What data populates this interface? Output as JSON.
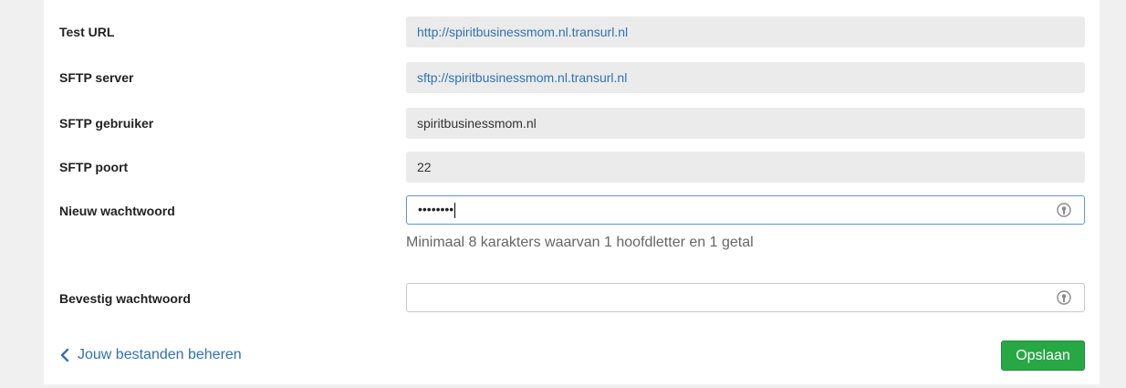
{
  "form": {
    "test_url": {
      "label": "Test URL",
      "value": "http://spiritbusinessmom.nl.transurl.nl"
    },
    "sftp_server": {
      "label": "SFTP server",
      "value": "sftp://spiritbusinessmom.nl.transurl.nl"
    },
    "sftp_user": {
      "label": "SFTP gebruiker",
      "value": "spiritbusinessmom.nl"
    },
    "sftp_port": {
      "label": "SFTP poort",
      "value": "22"
    },
    "new_password": {
      "label": "Nieuw wachtwoord",
      "masked_value": "••••••••",
      "hint": "Minimaal 8 karakters waarvan 1 hoofdletter en 1 getal",
      "icon": "reveal-password-icon"
    },
    "confirm_password": {
      "label": "Bevestig wachtwoord",
      "value": "",
      "icon": "reveal-password-icon"
    }
  },
  "footer": {
    "back_link_label": "Jouw bestanden beheren",
    "back_icon": "chevron-left-icon",
    "save_label": "Opslaan"
  },
  "colors": {
    "link": "#2f73b6",
    "save_button": "#28a745",
    "focus_border": "#5b9bd5"
  }
}
